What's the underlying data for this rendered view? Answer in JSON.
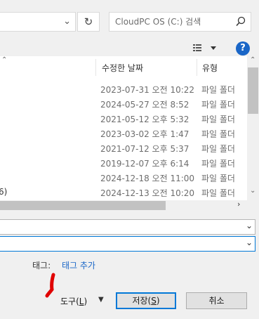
{
  "search": {
    "placeholder": "CloudPC OS (C:) 검색"
  },
  "toolbar": {
    "help_label": "?"
  },
  "columns": {
    "modified": "수정한 날짜",
    "type": "유형"
  },
  "rows": [
    {
      "name": "",
      "modified": "2023-07-31 오전 10:22",
      "type": "파일 폴더"
    },
    {
      "name": "",
      "modified": "2024-05-27 오전 8:52",
      "type": "파일 폴더"
    },
    {
      "name": "",
      "modified": "2021-05-12 오후 5:32",
      "type": "파일 폴더"
    },
    {
      "name": "",
      "modified": "2023-03-02 오후 1:47",
      "type": "파일 폴더"
    },
    {
      "name": "",
      "modified": "2021-07-12 오후 5:37",
      "type": "파일 폴더"
    },
    {
      "name": "",
      "modified": "2019-12-07 오후 6:14",
      "type": "파일 폴더"
    },
    {
      "name": "",
      "modified": "2024-12-18 오전 11:00",
      "type": "파일 폴더"
    },
    {
      "name": "6)",
      "modified": "2024-12-13 오전 10:20",
      "type": "파일 폴더"
    }
  ],
  "tags": {
    "label": "태그:",
    "add_link": "태그 추가"
  },
  "footer": {
    "tools_label": "도구",
    "tools_key": "L",
    "save_label": "저장",
    "save_key": "S",
    "cancel_label": "취소"
  },
  "icons": {
    "refresh": "refresh-icon",
    "search": "search-icon",
    "view": "view-options-icon",
    "help": "help-icon"
  },
  "colors": {
    "accent": "#0078d7",
    "link": "#1a66c7",
    "annotation": "#e00000"
  }
}
